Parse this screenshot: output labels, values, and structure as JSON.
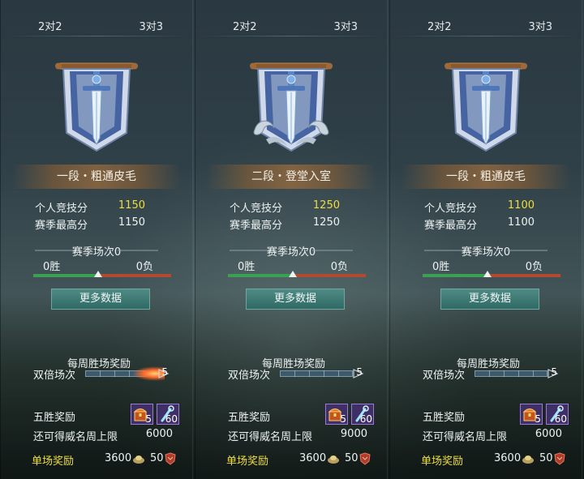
{
  "colors": {
    "gold_text": "#f0de3a",
    "win_bar": "#3aa152",
    "loss_bar": "#b14a2e",
    "button": "#3f7a75"
  },
  "panels": [
    {
      "tabs": [
        "2对2",
        "3对3"
      ],
      "emblem": "sword-banner-icon",
      "rank": "一段・粗通皮毛",
      "stats": [
        {
          "label": "个人竞技分",
          "value": "1150"
        },
        {
          "label": "赛季最高分",
          "value": "1150"
        }
      ],
      "season_title": "赛季场次0",
      "wins": "0胜",
      "losses": "0负",
      "more_button": "更多数据",
      "weekly_title": "每周胜场奖励",
      "double_label": "双倍场次",
      "double_count": "5",
      "five_win_label": "五胜奖励",
      "item_chest_count": "5",
      "item_key_count": "60",
      "cap_label": "还可得威名周上限",
      "cap_value": "6000",
      "single_label": "单场奖励",
      "coin_value": "3600",
      "honor_value": "50"
    },
    {
      "tabs": [
        "2对2",
        "3对3"
      ],
      "emblem": "sword-banner-cloud-icon",
      "rank": "二段・登堂入室",
      "stats": [
        {
          "label": "个人竞技分",
          "value": "1250"
        },
        {
          "label": "赛季最高分",
          "value": "1250"
        }
      ],
      "season_title": "赛季场次0",
      "wins": "0胜",
      "losses": "0负",
      "more_button": "更多数据",
      "weekly_title": "每周胜场奖励",
      "double_label": "双倍场次",
      "double_count": "5",
      "five_win_label": "五胜奖励",
      "item_chest_count": "5",
      "item_key_count": "60",
      "cap_label": "还可得威名周上限",
      "cap_value": "9000",
      "single_label": "单场奖励",
      "coin_value": "3600",
      "honor_value": "50"
    },
    {
      "tabs": [
        "2对2",
        "3对3"
      ],
      "emblem": "sword-banner-icon",
      "rank": "一段・粗通皮毛",
      "stats": [
        {
          "label": "个人竞技分",
          "value": "1100"
        },
        {
          "label": "赛季最高分",
          "value": "1100"
        }
      ],
      "season_title": "赛季场次0",
      "wins": "0胜",
      "losses": "0负",
      "more_button": "更多数据",
      "weekly_title": "每周胜场奖励",
      "double_label": "双倍场次",
      "double_count": "5",
      "five_win_label": "五胜奖励",
      "item_chest_count": "5",
      "item_key_count": "60",
      "cap_label": "还可得威名周上限",
      "cap_value": "6000",
      "single_label": "单场奖励",
      "coin_value": "3600",
      "honor_value": "50"
    }
  ]
}
